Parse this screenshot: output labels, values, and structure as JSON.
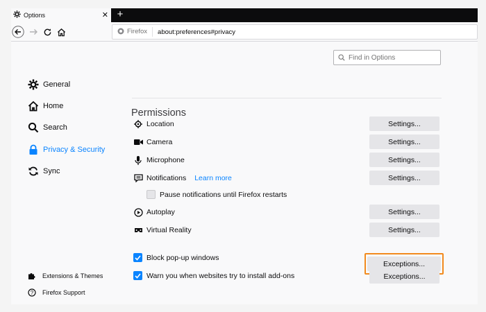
{
  "tab": {
    "title": "Options"
  },
  "navbar": {
    "identity": "Firefox",
    "url": "about:preferences#privacy"
  },
  "find": {
    "placeholder": "Find in Options"
  },
  "sidebar": {
    "items": [
      {
        "label": "General",
        "icon": "gear-icon"
      },
      {
        "label": "Home",
        "icon": "home-icon"
      },
      {
        "label": "Search",
        "icon": "search-icon"
      },
      {
        "label": "Privacy & Security",
        "icon": "lock-icon",
        "active": true
      },
      {
        "label": "Sync",
        "icon": "sync-icon"
      }
    ],
    "footer": [
      {
        "label": "Extensions & Themes",
        "icon": "puzzle-icon"
      },
      {
        "label": "Firefox Support",
        "icon": "help-icon"
      }
    ]
  },
  "permissions": {
    "title": "Permissions",
    "items": [
      {
        "label": "Location",
        "button": "Settings..."
      },
      {
        "label": "Camera",
        "button": "Settings..."
      },
      {
        "label": "Microphone",
        "button": "Settings..."
      },
      {
        "label": "Notifications",
        "link": "Learn more",
        "button": "Settings..."
      },
      {
        "label": "Pause notifications until Firefox restarts"
      },
      {
        "label": "Autoplay",
        "button": "Settings..."
      },
      {
        "label": "Virtual Reality",
        "button": "Settings..."
      }
    ],
    "checks": [
      {
        "label": "Block pop-up windows",
        "checked": true,
        "button": "Exceptions..."
      },
      {
        "label": "Warn you when websites try to install add-ons",
        "checked": true,
        "button": "Exceptions..."
      }
    ]
  },
  "colors": {
    "accent": "#0a84ff",
    "highlight": "#f28a1d"
  }
}
